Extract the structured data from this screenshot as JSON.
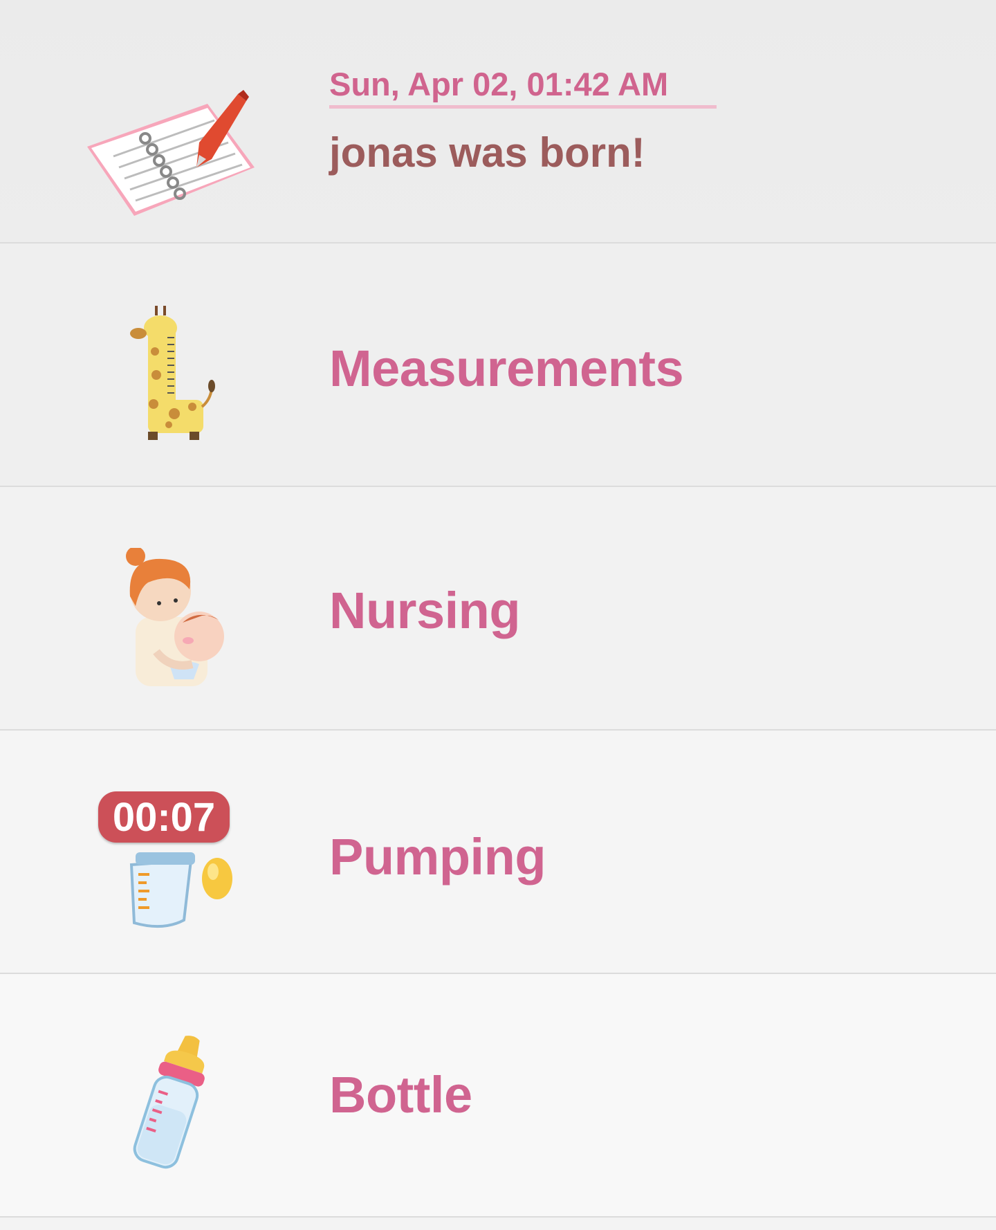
{
  "header_entry": {
    "date": "Sun, Apr 02, 01:42 AM",
    "note": "jonas was born!"
  },
  "items": [
    {
      "label": "Measurements",
      "icon": "giraffe-ruler-icon"
    },
    {
      "label": "Nursing",
      "icon": "mother-baby-icon"
    },
    {
      "label": "Pumping",
      "icon": "breast-pump-icon",
      "timer": "00:07"
    },
    {
      "label": "Bottle",
      "icon": "baby-bottle-icon"
    }
  ],
  "colors": {
    "label": "#d06490",
    "note": "#9c5c5c",
    "timer_bg": "#cc5058",
    "background": "#f3f3f3"
  }
}
